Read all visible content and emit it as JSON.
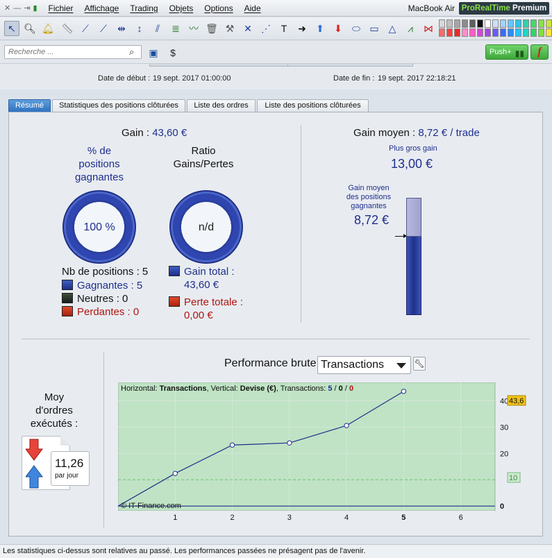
{
  "menu": {
    "items": [
      "Fichier",
      "Affichage",
      "Trading",
      "Objets",
      "Options",
      "Aide"
    ],
    "device": "MacBook Air",
    "brand_name": "ProRealTime",
    "brand_tier": "Premium"
  },
  "toolbar": {
    "palette": [
      "#d8d8d8",
      "#bfbfbf",
      "#a6a6a6",
      "#8c8c8c",
      "#5e5e5e",
      "#111111",
      "#ffffff",
      "#cfe0ff",
      "#9fd3ff",
      "#65c7ff",
      "#2ec3e8",
      "#31d2a7",
      "#45d86a",
      "#8be04a",
      "#cde03c",
      "#ff6b6b",
      "#ff4040",
      "#e82a2a",
      "#ff8fc7",
      "#ff5cc2",
      "#d14ad6",
      "#a24ae0",
      "#6b5cff",
      "#3b6cff",
      "#2b8cff",
      "#22c3ff",
      "#19d9c3",
      "#2ed66a",
      "#7fe03a",
      "#ffe13a"
    ]
  },
  "search": {
    "placeholder": "Recherche ..."
  },
  "actions": {
    "push_label": "Push+",
    "function_label": "f"
  },
  "dates": {
    "start_label": "Date de début :",
    "start_value": "19 sept. 2017 01:00:00",
    "end_label": "Date de fin :",
    "end_value": "19 sept. 2017 22:18:21"
  },
  "tabs": [
    {
      "label": "Résumé",
      "active": true
    },
    {
      "label": "Statistiques des positions clôturées",
      "active": false
    },
    {
      "label": "Liste des ordres",
      "active": false
    },
    {
      "label": "Liste des positions clôturées",
      "active": false
    }
  ],
  "summary": {
    "gain_label": "Gain :",
    "gain_value": "43,60 €",
    "pct_title": [
      "% de",
      "positions",
      "gagnantes"
    ],
    "pct_value": "100 %",
    "ratio_title": [
      "Ratio",
      "Gains/Pertes"
    ],
    "ratio_value": "n/d",
    "nb_positions_label": "Nb de positions : 5",
    "gagnantes_label": "Gagnantes : 5",
    "neutres_label": "Neutres : 0",
    "perdantes_label": "Perdantes : 0",
    "gain_total_label": "Gain total :",
    "gain_total_value": "43,60 €",
    "perte_totale_label": "Perte totale :",
    "perte_totale_value": "0,00 €"
  },
  "average": {
    "label": "Gain moyen :",
    "value": "8,72 € / trade",
    "biggest_label": "Plus gros gain",
    "biggest_value": "13,00 €",
    "avg_win_label": [
      "Gain moyen",
      "des positions",
      "gagnantes"
    ],
    "avg_win_value": "8,72 €",
    "bar_fraction": 0.67
  },
  "orders": {
    "title": [
      "Moy",
      "d'ordres",
      "exécutés :"
    ],
    "value": "11,26",
    "unit": "par jour"
  },
  "performance": {
    "title": "Performance brute",
    "select_value": "Transactions",
    "info_h_label": "Horizontal: ",
    "info_h_value": "Transactions",
    "info_v_label": ", Vertical: ",
    "info_v_value": "Devise (€)",
    "info_t_label": ", Transactions: ",
    "info_t_win": "5",
    "info_t_sep1": " / ",
    "info_t_neutral": "0",
    "info_t_sep2": " / ",
    "info_t_loss": "0",
    "copyright": "© IT-Finance.com",
    "reference_value_label": "10",
    "last_value_label": "43,6"
  },
  "chart_data": {
    "type": "line",
    "x": [
      0,
      1,
      2,
      3,
      4,
      5
    ],
    "y": [
      0,
      12.4,
      23.2,
      24.0,
      30.6,
      43.6
    ],
    "reference_line": 10,
    "x_ticks": [
      "1",
      "2",
      "3",
      "4",
      "5",
      "6"
    ],
    "y_ticks": [
      "0",
      "20",
      "30",
      "40"
    ],
    "xlim": [
      0,
      6.6
    ],
    "ylim": [
      -1.8,
      47
    ],
    "grid": true,
    "colors": {
      "line": "#1f2e8c",
      "area": "#bfe3c4",
      "reference": "#6fbf76",
      "highlight": "#f2c218"
    }
  },
  "status": {
    "text": "Les statistiques ci-dessus sont relatives au passé. Les performances passées ne présagent pas de l'avenir."
  }
}
